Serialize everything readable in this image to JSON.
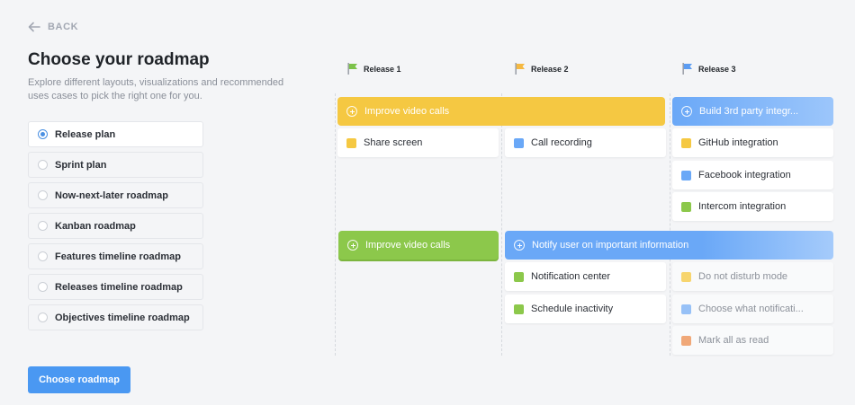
{
  "back_label": "BACK",
  "title": "Choose your roadmap",
  "subtitle": "Explore different layouts, visualizations and recommended uses cases to pick the right one for you.",
  "options": [
    {
      "label": "Release plan",
      "selected": true
    },
    {
      "label": "Sprint plan",
      "selected": false
    },
    {
      "label": "Now-next-later roadmap",
      "selected": false
    },
    {
      "label": "Kanban roadmap",
      "selected": false
    },
    {
      "label": "Features timeline roadmap",
      "selected": false
    },
    {
      "label": "Releases timeline roadmap",
      "selected": false
    },
    {
      "label": "Objectives timeline roadmap",
      "selected": false
    }
  ],
  "cta_label": "Choose roadmap",
  "colors": {
    "green": "#8cc84b",
    "yellow": "#f5c842",
    "blue": "#6aa8f7",
    "orange": "#f0a070",
    "accent": "#4a98f2"
  },
  "releases": [
    {
      "label": "Release 1",
      "flag_color": "#7cc24a"
    },
    {
      "label": "Release 2",
      "flag_color": "#f5b942"
    },
    {
      "label": "Release 3",
      "flag_color": "#5b9cf2"
    }
  ],
  "epics": [
    {
      "label": "Improve video calls",
      "color": "yellow"
    },
    {
      "label": "Build 3rd party integr...",
      "color": "blue"
    },
    {
      "label": "Improve video calls",
      "color": "green"
    },
    {
      "label": "Notify user on important information",
      "color": "blue"
    }
  ],
  "cards": [
    {
      "label": "Share screen",
      "color": "yellow"
    },
    {
      "label": "Call recording",
      "color": "blue"
    },
    {
      "label": "GitHub integration",
      "color": "yellow"
    },
    {
      "label": "Facebook integration",
      "color": "blue"
    },
    {
      "label": "Intercom integration",
      "color": "green"
    },
    {
      "label": "Notification center",
      "color": "green"
    },
    {
      "label": "Schedule inactivity",
      "color": "green"
    },
    {
      "label": "Do not disturb mode",
      "color": "yellow"
    },
    {
      "label": "Choose what notificati...",
      "color": "blue"
    },
    {
      "label": "Mark all as read",
      "color": "orange"
    }
  ]
}
